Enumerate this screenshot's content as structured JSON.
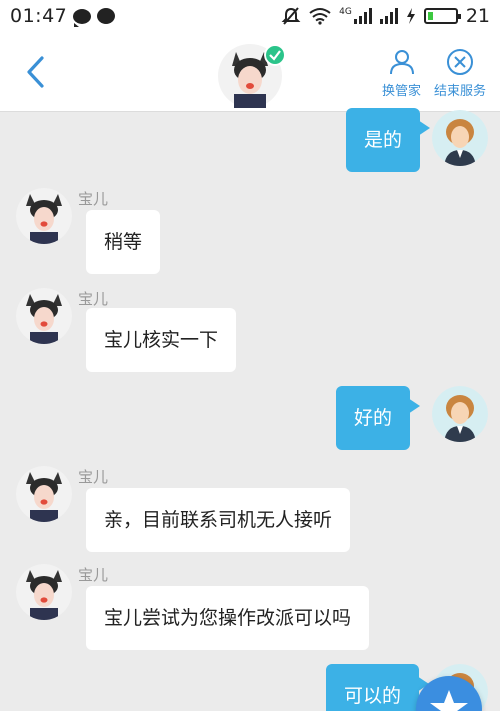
{
  "status_bar": {
    "time": "01:47",
    "network_label": "4G",
    "battery_level": "21",
    "battery_fill_fraction": 0.21,
    "icons": [
      "chat-bubble-icon",
      "message-icon",
      "mute-icon",
      "wifi-icon",
      "signal-icon",
      "charging-icon",
      "battery-icon"
    ]
  },
  "header": {
    "actions": [
      {
        "label": "换管家",
        "icon": "person-icon"
      },
      {
        "label": "结束服务",
        "icon": "close-circle-icon"
      }
    ],
    "icons": [
      "back-arrow-icon",
      "verified-check-icon"
    ]
  },
  "messages": [
    {
      "direction": "out",
      "text": "是的"
    },
    {
      "direction": "in",
      "sender": "宝儿",
      "text": "稍等"
    },
    {
      "direction": "in",
      "sender": "宝儿",
      "text": "宝儿核实一下"
    },
    {
      "direction": "out",
      "text": "好的"
    },
    {
      "direction": "in",
      "sender": "宝儿",
      "text": "亲，目前联系司机无人接听"
    },
    {
      "direction": "in",
      "sender": "宝儿",
      "text": "宝儿尝试为您操作改派可以吗"
    },
    {
      "direction": "out",
      "text": "可以的"
    }
  ],
  "colors": {
    "accent_blue": "#3cb1e6",
    "header_link": "#3a90d6",
    "background": "#ebebeb",
    "verified_green": "#2bc48a",
    "battery_green": "#3cc840"
  },
  "fab_icon": "star-icon"
}
